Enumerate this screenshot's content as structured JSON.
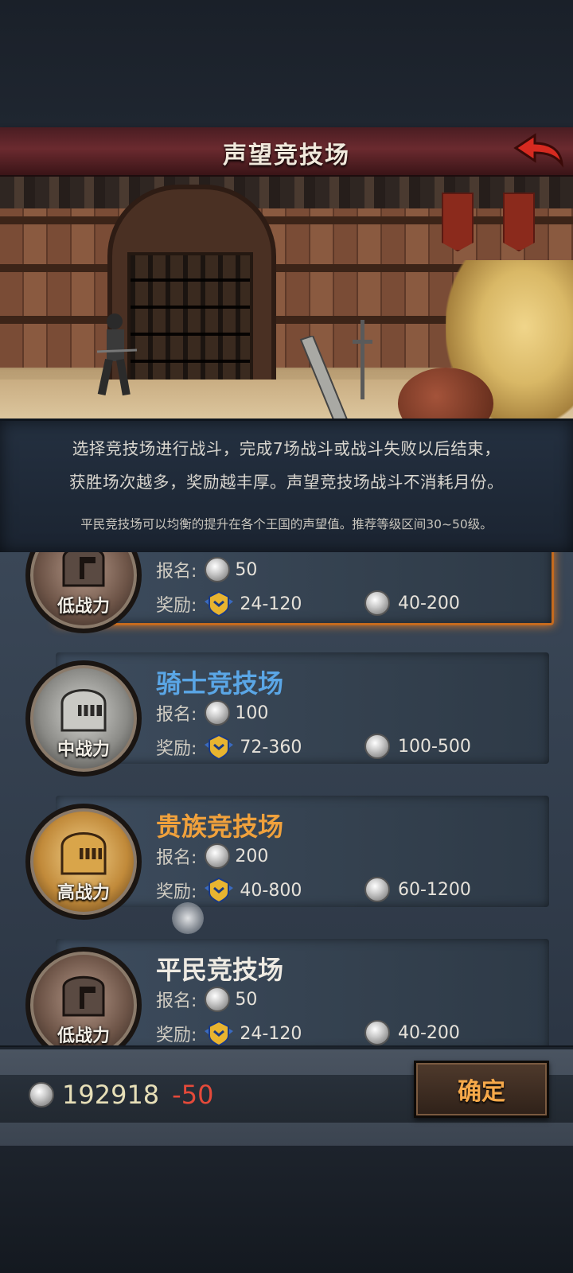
{
  "header": {
    "title": "声望竞技场"
  },
  "description": {
    "line1": "选择竞技场进行战斗，完成7场战斗或战斗失败以后结束，",
    "line2": "获胜场次越多，奖励越丰厚。声望竞技场战斗不消耗月份。",
    "sub": "平民竞技场可以均衡的提升在各个王国的声望值。推荐等级区间30~50级。"
  },
  "arenas": [
    {
      "name": "",
      "badge": "低战力",
      "signup_label": "报名:",
      "fee": "50",
      "reward_label": "奖励:",
      "reward_rep": "24-120",
      "reward_coin": "40-200",
      "selected": true
    },
    {
      "name": "骑士竞技场",
      "badge": "中战力",
      "signup_label": "报名:",
      "fee": "100",
      "reward_label": "奖励:",
      "reward_rep": "72-360",
      "reward_coin": "100-500"
    },
    {
      "name": "贵族竞技场",
      "badge": "高战力",
      "signup_label": "报名:",
      "fee": "200",
      "reward_label": "奖励:",
      "reward_rep": "40-800",
      "reward_coin": "60-1200"
    },
    {
      "name": "平民竞技场",
      "badge": "低战力",
      "signup_label": "报名:",
      "fee": "50",
      "reward_label": "奖励:",
      "reward_rep": "24-120",
      "reward_coin": "40-200"
    }
  ],
  "footer": {
    "balance": "192918",
    "delta": "-50",
    "confirm_label": "确定"
  },
  "colors": {
    "accent": "#f0a13c",
    "knight_blue": "#5aa6e6",
    "delta_red": "#e54a3a"
  }
}
